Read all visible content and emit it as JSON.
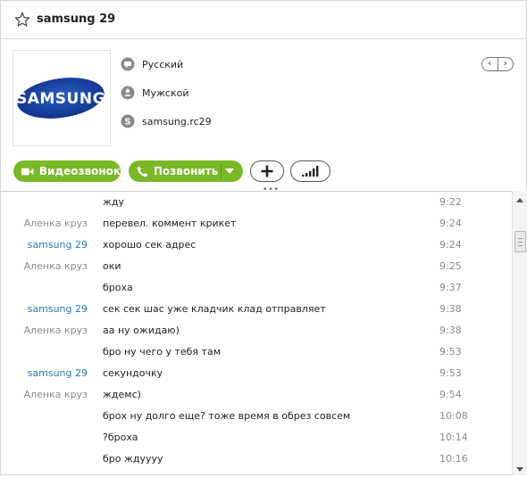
{
  "header": {
    "title": "samsung 29"
  },
  "profile": {
    "language": "Русский",
    "gender": "Мужской",
    "skype_name": "samsung.rc29",
    "logo_text": "SAMSUNG",
    "nav_prev": "‹",
    "nav_next": "›"
  },
  "actions": {
    "video_call_label": "Видеозвонок",
    "call_label": "Позвонить"
  },
  "colors": {
    "accent_green": "#7ab828",
    "self_sender": "#2a78b4",
    "other_sender": "#8a8a8a"
  },
  "chat": {
    "messages": [
      {
        "sender": "",
        "text": "жду",
        "time": "9:22"
      },
      {
        "sender": "Аленка круз",
        "text": "перевел. коммент крикет",
        "time": "9:24"
      },
      {
        "sender": "samsung 29",
        "text": "хорошо сек адрес",
        "time": "9:24"
      },
      {
        "sender": "Аленка круз",
        "text": "оки",
        "time": "9:25"
      },
      {
        "sender": "",
        "text": "броха",
        "time": "9:37"
      },
      {
        "sender": "samsung 29",
        "text": "сек сек шас уже кладчик клад отправляет",
        "time": "9:38"
      },
      {
        "sender": "Аленка круз",
        "text": "аа ну ожидаю)",
        "time": "9:38"
      },
      {
        "sender": "",
        "text": "бро ну чего у тебя там",
        "time": "9:53"
      },
      {
        "sender": "samsung 29",
        "text": "секундочку",
        "time": "9:53"
      },
      {
        "sender": "Аленка круз",
        "text": "ждемс)",
        "time": "9:54"
      },
      {
        "sender": "",
        "text": "брох ну долго еще? тоже время в обрез совсем",
        "time": "10:08"
      },
      {
        "sender": "",
        "text": "?броха",
        "time": "10:14"
      },
      {
        "sender": "",
        "text": "бро ждуууу",
        "time": "10:16"
      }
    ]
  }
}
